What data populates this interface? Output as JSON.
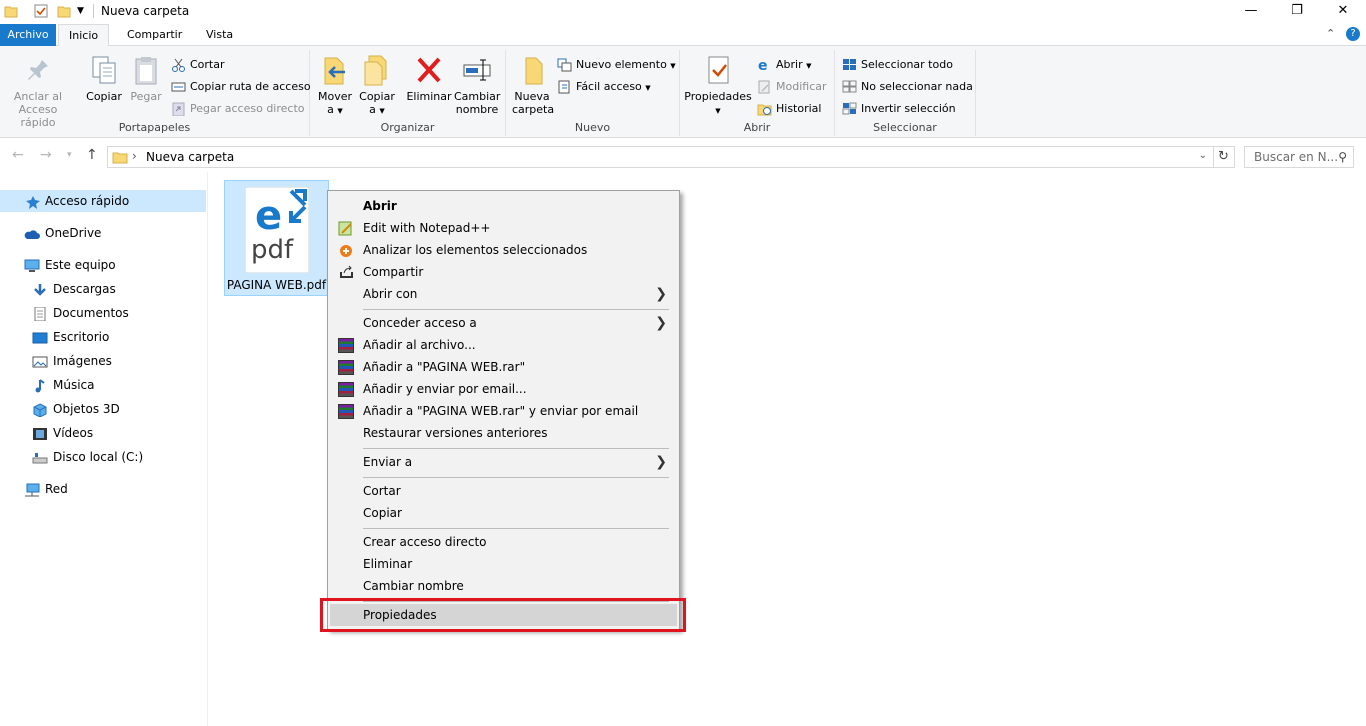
{
  "window": {
    "title": "Nueva carpeta",
    "minimize_icon": "—",
    "maximize_icon": "❐",
    "close_icon": "✕"
  },
  "tabs": {
    "file": "Archivo",
    "home": "Inicio",
    "share": "Compartir",
    "view": "Vista"
  },
  "ribbon": {
    "portapapeles": {
      "label": "Portapapeles",
      "pin": "Anclar al\nAcceso rápido",
      "copy": "Copiar",
      "paste": "Pegar",
      "cut": "Cortar",
      "copy_path": "Copiar ruta de acceso",
      "paste_shortcut": "Pegar acceso directo"
    },
    "organizar": {
      "label": "Organizar",
      "move": "Mover\na",
      "copy_to": "Copiar\na",
      "delete": "Eliminar",
      "rename": "Cambiar\nnombre"
    },
    "nuevo": {
      "label": "Nuevo",
      "new_folder": "Nueva\ncarpeta",
      "new_item": "Nuevo elemento",
      "easy_access": "Fácil acceso"
    },
    "abrir": {
      "label": "Abrir",
      "properties": "Propiedades",
      "open": "Abrir",
      "edit": "Modificar",
      "history": "Historial"
    },
    "seleccionar": {
      "label": "Seleccionar",
      "select_all": "Seleccionar todo",
      "select_none": "No seleccionar nada",
      "invert": "Invertir selección"
    }
  },
  "address": {
    "path": "Nueva carpeta",
    "search_placeholder": "Buscar en N..."
  },
  "sidebar": {
    "items": [
      {
        "label": "Acceso rápido"
      },
      {
        "label": "OneDrive"
      },
      {
        "label": "Este equipo"
      },
      {
        "label": "Descargas"
      },
      {
        "label": "Documentos"
      },
      {
        "label": "Escritorio"
      },
      {
        "label": "Imágenes"
      },
      {
        "label": "Música"
      },
      {
        "label": "Objetos 3D"
      },
      {
        "label": "Vídeos"
      },
      {
        "label": "Disco local (C:)"
      },
      {
        "label": "Red"
      }
    ]
  },
  "file": {
    "name": "PAGINA WEB.pdf",
    "icon_text": "pdf"
  },
  "context_menu": {
    "items": [
      {
        "label": "Abrir"
      },
      {
        "label": "Edit with Notepad++"
      },
      {
        "label": "Analizar los elementos seleccionados"
      },
      {
        "label": "Compartir"
      },
      {
        "label": "Abrir con"
      },
      {
        "label": "Conceder acceso a"
      },
      {
        "label": "Añadir al archivo..."
      },
      {
        "label": "Añadir a \"PAGINA WEB.rar\""
      },
      {
        "label": "Añadir y enviar por email..."
      },
      {
        "label": "Añadir a \"PAGINA WEB.rar\" y enviar por email"
      },
      {
        "label": "Restaurar versiones anteriores"
      },
      {
        "label": "Enviar a"
      },
      {
        "label": "Cortar"
      },
      {
        "label": "Copiar"
      },
      {
        "label": "Crear acceso directo"
      },
      {
        "label": "Eliminar"
      },
      {
        "label": "Cambiar nombre"
      },
      {
        "label": "Propiedades"
      }
    ]
  },
  "colors": {
    "accent": "#1979ca",
    "selection": "#cce8ff",
    "highlight_border": "#e0141e"
  }
}
